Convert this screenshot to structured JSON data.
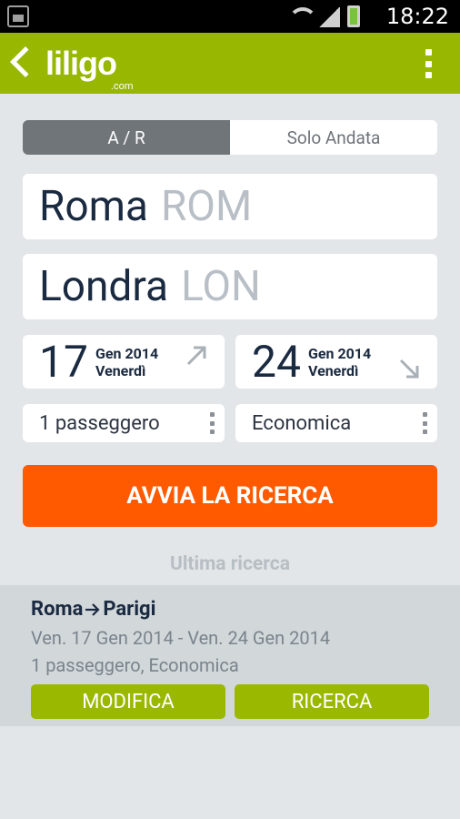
{
  "status_bar": {
    "time": "18:22"
  },
  "app_bar": {
    "logo": "liligo",
    "logo_suffix": ".com"
  },
  "trip_tabs": {
    "round_trip": "A / R",
    "one_way": "Solo Andata"
  },
  "origin": {
    "city": "Roma",
    "code": "ROM"
  },
  "destination": {
    "city": "Londra",
    "code": "LON"
  },
  "depart_date": {
    "day": "17",
    "month_year": "Gen 2014",
    "weekday": "Venerdì"
  },
  "return_date": {
    "day": "24",
    "month_year": "Gen 2014",
    "weekday": "Venerdì"
  },
  "passengers": {
    "label": "1 passeggero"
  },
  "cabin": {
    "label": "Economica"
  },
  "search_button": "AVVIA LA RICERCA",
  "last_search": {
    "title": "Ultima ricerca",
    "from": "Roma",
    "to": "Parigi",
    "dates": "Ven. 17 Gen 2014 - Ven. 24 Gen 2014",
    "details": "1 passeggero, Economica",
    "modify_label": "MODIFICA",
    "search_label": "RICERCA"
  },
  "colors": {
    "brand_green": "#97b700",
    "search_orange": "#ff5a00",
    "tab_active": "#70757a"
  }
}
